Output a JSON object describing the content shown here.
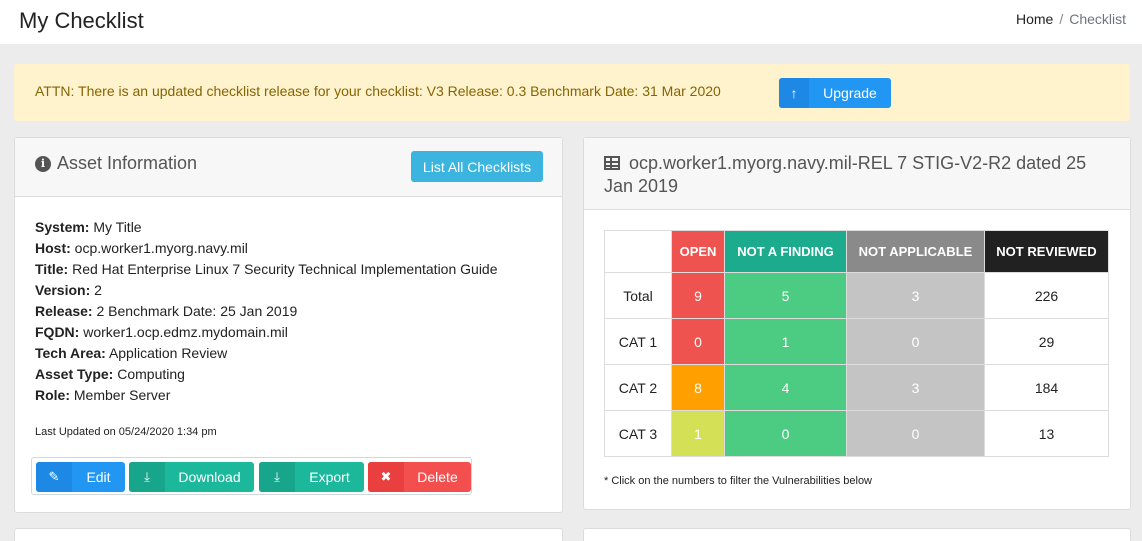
{
  "header": {
    "title": "My Checklist"
  },
  "breadcrumb": {
    "home": "Home",
    "separator": "/",
    "current": "Checklist"
  },
  "alert": {
    "text": "ATTN: There is an updated checklist release for your checklist: V3 Release: 0.3 Benchmark Date: 31 Mar 2020",
    "button_label": "Upgrade",
    "button_icon": "arrow-up-icon"
  },
  "asset": {
    "title": "Asset Information",
    "list_button": "List All Checklists",
    "fields": [
      {
        "label": "System:",
        "value": "My Title"
      },
      {
        "label": "Host:",
        "value": "ocp.worker1.myorg.navy.mil"
      },
      {
        "label": "Title:",
        "value": "Red Hat Enterprise Linux 7 Security Technical Implementation Guide"
      },
      {
        "label": "Version:",
        "value": "2"
      },
      {
        "label": "Release:",
        "value": "2 Benchmark Date: 25 Jan 2019"
      },
      {
        "label": "FQDN:",
        "value": "worker1.ocp.edmz.mydomain.mil"
      },
      {
        "label": "Tech Area:",
        "value": "Application Review"
      },
      {
        "label": "Asset Type:",
        "value": "Computing"
      },
      {
        "label": "Role:",
        "value": "Member Server"
      }
    ],
    "last_updated": "Last Updated on 05/24/2020 1:34 pm",
    "buttons": {
      "edit": "Edit",
      "download": "Download",
      "export": "Export",
      "delete": "Delete"
    }
  },
  "stig": {
    "title": "ocp.worker1.myorg.navy.mil-REL 7 STIG-V2-R2 dated 25 Jan 2019",
    "headers": {
      "open": "OPEN",
      "naf": "NOT A FINDING",
      "na": "NOT APPLICABLE",
      "nr": "NOT REVIEWED"
    },
    "rows": [
      {
        "label": "Total",
        "open": "9",
        "naf": "5",
        "na": "3",
        "nr": "226"
      },
      {
        "label": "CAT 1",
        "open": "0",
        "naf": "1",
        "na": "0",
        "nr": "29"
      },
      {
        "label": "CAT 2",
        "open": "8",
        "naf": "4",
        "na": "3",
        "nr": "184"
      },
      {
        "label": "CAT 3",
        "open": "1",
        "naf": "0",
        "na": "0",
        "nr": "13"
      }
    ],
    "note": "* Click on the numbers to filter the Vulnerabilities below"
  },
  "colors": {
    "open": "#ef5350",
    "cat2_open": "#ffa000",
    "cat3_open": "#d4e157",
    "naf_header": "#1cab8c",
    "naf": "#4ccc82",
    "na_header": "#8a8a8a",
    "na": "#c4c4c4",
    "nr_header": "#212121",
    "alert_bg": "#fff3cd",
    "primary": "#2196f3",
    "info": "#3bb5e0",
    "success": "#1cb89b",
    "danger": "#f44f4f"
  }
}
